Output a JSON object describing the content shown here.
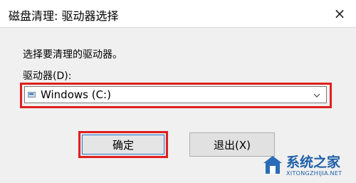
{
  "window": {
    "title": "磁盘清理: 驱动器选择",
    "close_icon": "×"
  },
  "dialog": {
    "prompt": "选择要清理的驱动器。",
    "drive_label": "驱动器(D):",
    "selected_drive": "Windows (C:)",
    "dropdown_icon": "chevron-down",
    "ok_label": "确定",
    "exit_label": "退出(X)"
  },
  "highlight_color": "#e02020",
  "watermark": {
    "brand": "系统之家",
    "url": "XITONGZHIJIA.NET"
  }
}
